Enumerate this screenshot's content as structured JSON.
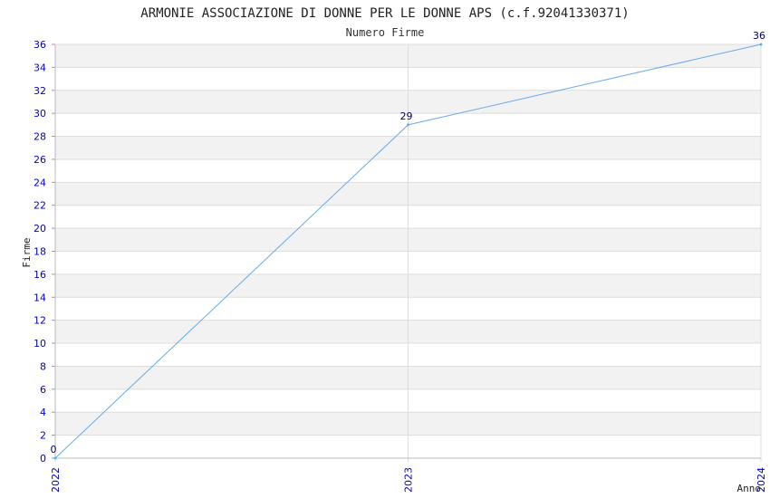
{
  "chart_data": {
    "type": "line",
    "title": "ARMONIE ASSOCIAZIONE DI DONNE PER LE DONNE APS (c.f.92041330371)",
    "subtitle": "Numero Firme",
    "xlabel": "Anno",
    "ylabel": "Firme",
    "x": [
      "2022",
      "2023",
      "2024"
    ],
    "series": [
      {
        "values": [
          0,
          29,
          36
        ]
      }
    ],
    "ylim": [
      0,
      36
    ],
    "y_ticks": [
      0,
      2,
      4,
      6,
      8,
      10,
      12,
      14,
      16,
      18,
      20,
      22,
      24,
      26,
      28,
      30,
      32,
      34,
      36
    ],
    "grid": true,
    "colors": {
      "line": "#66aaee",
      "band": "#f2f2f2",
      "gridline": "#dddddd",
      "tick_text": "#0000cc",
      "value_label": "#000066"
    }
  }
}
